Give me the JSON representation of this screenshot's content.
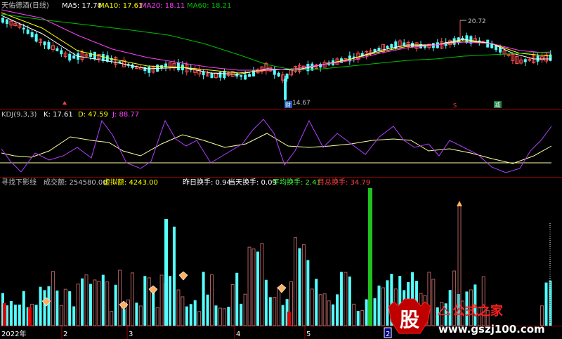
{
  "header": {
    "stock": "天佑德酒(日线)",
    "ma5": "MA5: 17.70",
    "ma10": "MA10: 17.61",
    "ma20": "MA20: 18.11",
    "ma60": "MA60: 18.21"
  },
  "price_panel": {
    "high_label": "20.72",
    "low_label": "14.67",
    "badges": [
      "财",
      "S",
      "减"
    ]
  },
  "kdj_panel": {
    "name": "KDJ(9,3,3)",
    "k": "K: 17.61",
    "d": "D: 47.59",
    "j": "J: 88.77"
  },
  "volume_panel": {
    "name": "寻找下影线",
    "volume_label": "成交额: 254580.00",
    "virtual_label": "虚拟额: 4243.00",
    "prev_turnover": "昨日换手: 0.94",
    "today_turnover": "当天换手: 0.09",
    "avg_turnover": "平均换手: 2.41",
    "month_turnover": "月总换手: 34.79"
  },
  "date_axis": {
    "year": "2022年",
    "months": [
      "2",
      "3",
      "4",
      "5",
      "2"
    ]
  },
  "watermark": {
    "big_char": "股",
    "name": "公式之家",
    "url": "www.gszj100.com"
  },
  "colors": {
    "up": "#ff5050",
    "down": "#54ffff",
    "ma5": "#ffffff",
    "ma10": "#ffff00",
    "ma20": "#ff40ff",
    "ma60": "#00c000",
    "kdj_j": "#b040ff",
    "kdj_d": "#ffffa0",
    "vol_up": "#b06060",
    "vol_down": "#54ffff",
    "vol_green": "#20c020",
    "vol_red": "#e00000"
  }
}
